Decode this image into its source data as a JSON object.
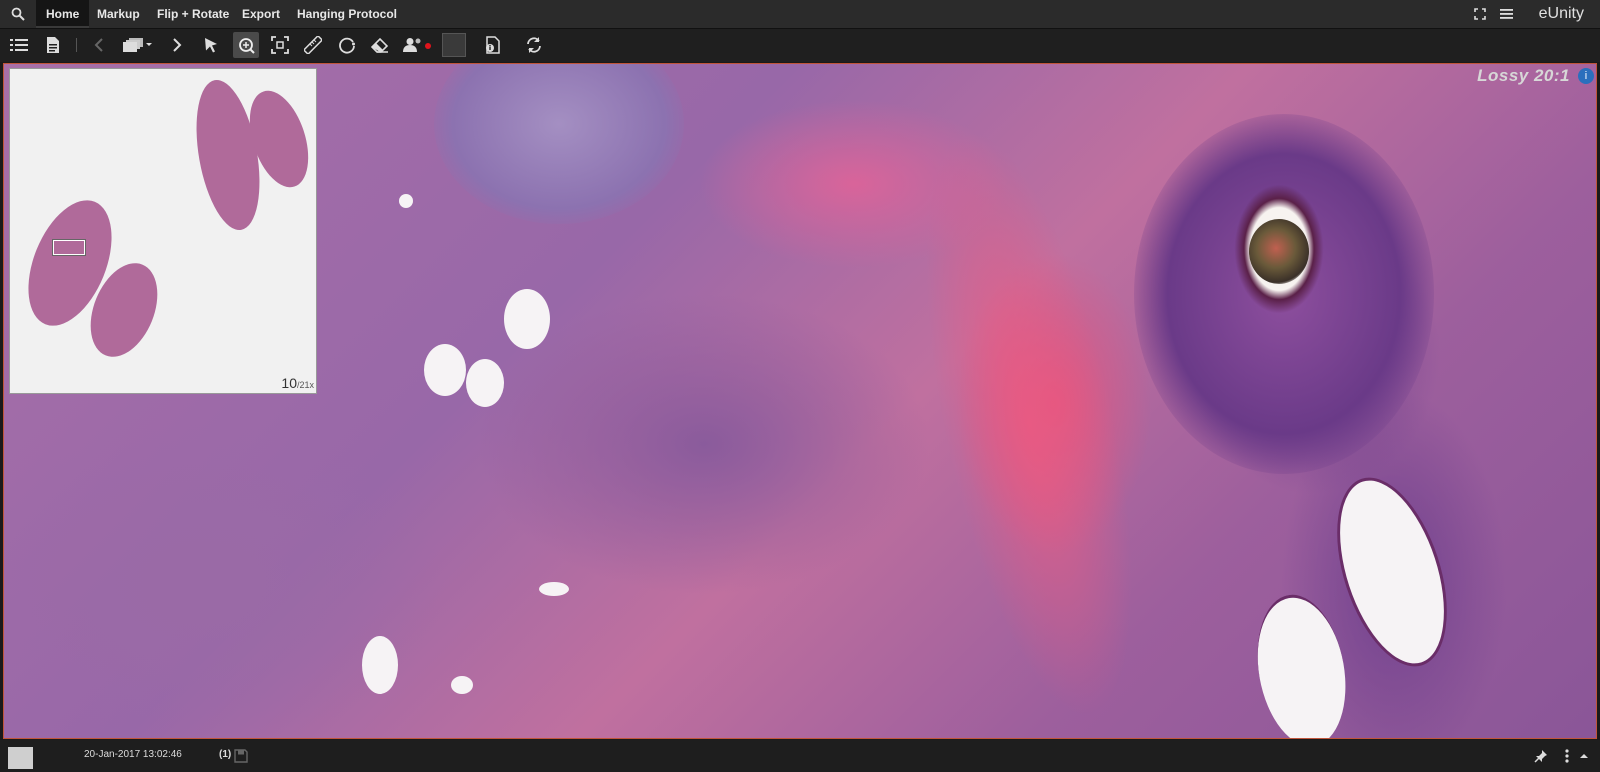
{
  "menu": {
    "tabs": [
      {
        "label": "Home"
      },
      {
        "label": "Markup"
      },
      {
        "label": "Flip + Rotate"
      },
      {
        "label": "Export"
      },
      {
        "label": "Hanging Protocol"
      }
    ],
    "brand": "eUnity"
  },
  "toolbar": {
    "icons": [
      "list-icon",
      "document-icon",
      "previous-icon",
      "stack-icon",
      "next-icon",
      "pointer-icon",
      "zoom-icon",
      "fit-icon",
      "ruler-icon",
      "ellipse-icon",
      "eraser-icon",
      "user-record-icon",
      "color-swatch",
      "info-document-icon",
      "refresh-icon"
    ],
    "active_tool": "zoom-icon",
    "swatch_color": "#3a3a3a"
  },
  "viewport": {
    "compression_label": "Lossy 20:1",
    "border_color": "#c0553a"
  },
  "overview": {
    "zoom_value": "10",
    "zoom_suffix": "/21x"
  },
  "status": {
    "timestamp": "20-Jan-2017 13:02:46",
    "count": "(1)"
  }
}
